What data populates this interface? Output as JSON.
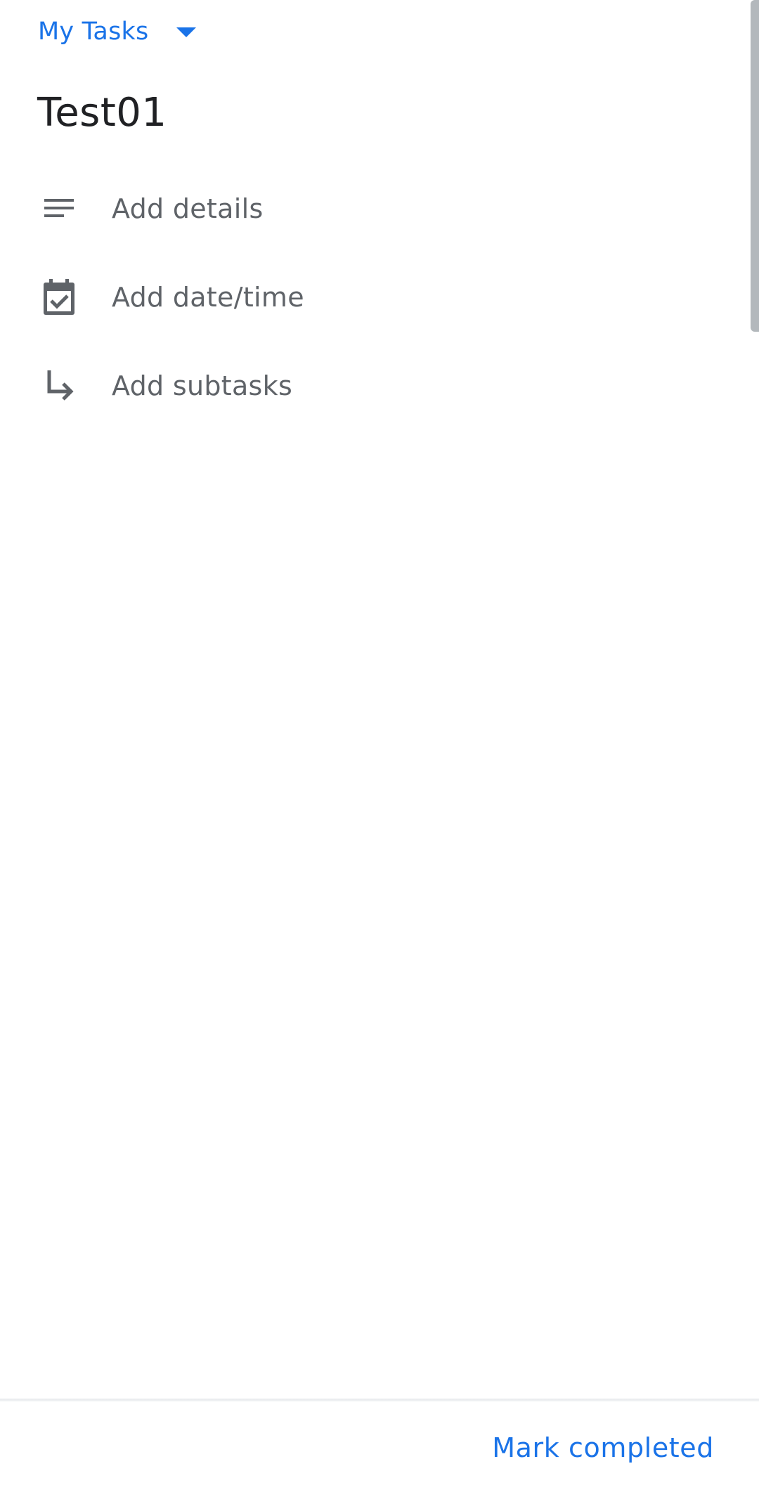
{
  "header": {
    "list_name": "My Tasks",
    "dropdown_icon": "arrow-drop-down-icon"
  },
  "task": {
    "title": "Test01"
  },
  "rows": [
    {
      "icon": "notes-lines-icon",
      "label": "Add details"
    },
    {
      "icon": "calendar-check-icon",
      "label": "Add date/time"
    },
    {
      "icon": "subdirectory-arrow-icon",
      "label": "Add subtasks"
    }
  ],
  "footer": {
    "mark_completed_label": "Mark completed"
  },
  "colors": {
    "accent": "#1a73e8",
    "text_primary": "#202124",
    "text_secondary": "#5f6368"
  }
}
